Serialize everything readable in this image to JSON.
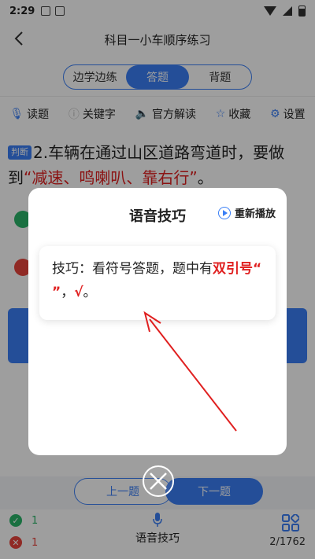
{
  "status": {
    "time": "2:29"
  },
  "header": {
    "title": "科目一小车顺序练习"
  },
  "tabs": [
    {
      "label": "边学边练"
    },
    {
      "label": "答题"
    },
    {
      "label": "背题"
    }
  ],
  "toolbar": {
    "read": "读题",
    "keyword": "关键字",
    "official": "官方解读",
    "favorite": "收藏",
    "settings": "设置"
  },
  "question": {
    "type_badge": "判断",
    "prefix": "2.车辆在通过山区道路弯道时，要做到",
    "highlight": "“减速、鸣喇叭、靠右行”",
    "suffix": "。"
  },
  "nav": {
    "prev": "上一题",
    "next": "下一题"
  },
  "bottom": {
    "correct_count": "1",
    "wrong_count": "1",
    "voice_label": "语音技巧",
    "progress": "2/1762"
  },
  "modal": {
    "title": "语音技巧",
    "replay": "重新播放",
    "tip_prefix": "技巧：看符号答题，题中有",
    "tip_red1": "双引号“ ”",
    "tip_mid": "，",
    "tip_red2": "√",
    "tip_end": "。"
  },
  "colors": {
    "accent": "#3a7ff6",
    "highlight": "#e02020",
    "correct": "#2ab56a",
    "wrong": "#e8453c"
  }
}
